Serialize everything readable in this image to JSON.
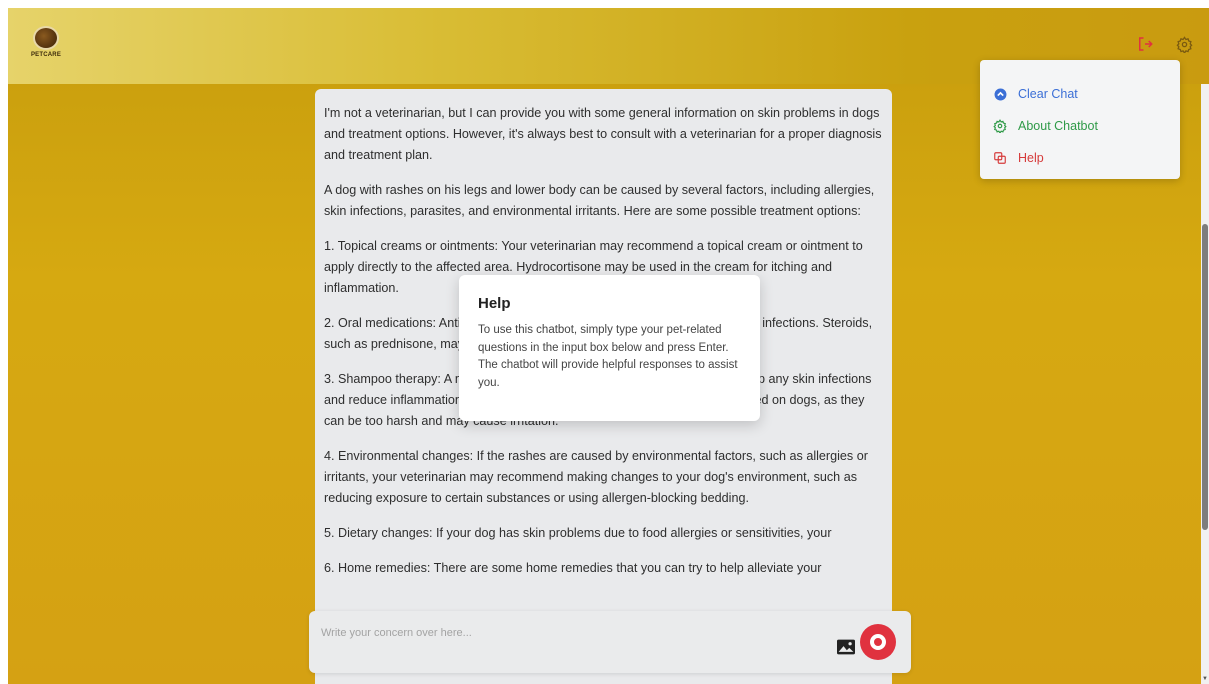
{
  "header": {
    "logo_text": "PETCARE"
  },
  "menu": {
    "items": [
      {
        "label": "Clear Chat",
        "icon": "clear-chat-icon",
        "color": "#3b6fd6"
      },
      {
        "label": "About Chatbot",
        "icon": "gear-icon",
        "color": "#2f9a48"
      },
      {
        "label": "Help",
        "icon": "help-icon",
        "color": "#d63b3b"
      }
    ]
  },
  "chat": {
    "paragraphs": [
      "I'm not a veterinarian, but I can provide you with some general information on skin problems in dogs and treatment options. However, it's always best to consult with a veterinarian for a proper diagnosis and treatment plan.",
      "A dog with rashes on his legs and lower body can be caused by several factors, including allergies, skin infections, parasites, and environmental irritants. Here are some possible treatment options:",
      "1. Topical creams or ointments: Your veterinarian may recommend a topical cream or ointment to apply directly to the affected area. Hydrocortisone may be used in the cream for itching and inflammation.",
      "2. Oral medications: Antibiotics may be prescribed to treat secondary bacterial infections. Steroids, such as prednisone, may also help reduce inflammation and itching.",
      "3. Shampoo therapy: A medicated shampoo may be prescribed to help clear up any skin infections and reduce inflammation. Human shampoo or conditioner should never be used on dogs, as they can be too harsh and may cause irritation.",
      "4. Environmental changes: If the rashes are caused by environmental factors, such as allergies or irritants, your veterinarian may recommend making changes to your dog's environment, such as reducing exposure to certain substances or using allergen-blocking bedding.",
      "5. Dietary changes: If your dog has skin problems due to food allergies or sensitivities, your",
      "6. Home remedies: There are some home remedies that you can try to help alleviate your"
    ]
  },
  "modal": {
    "title": "Help",
    "body": "To use this chatbot, simply type your pet-related questions in the input box below and press Enter. The chatbot will provide helpful responses to assist you."
  },
  "composer": {
    "placeholder": "Write your concern over here..."
  }
}
